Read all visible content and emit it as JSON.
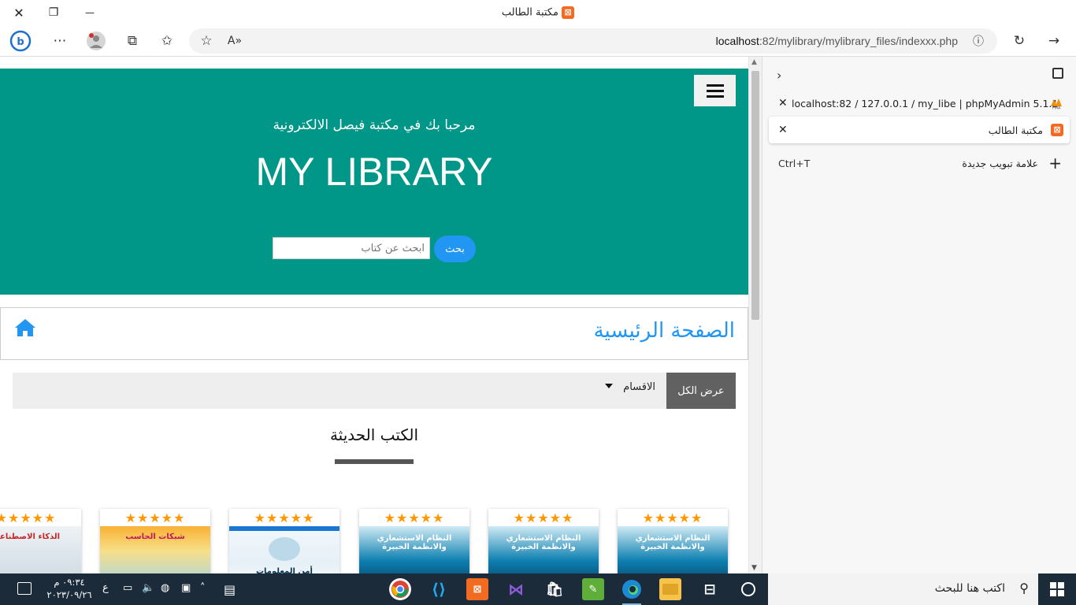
{
  "window": {
    "title": "مكتبة الطالب",
    "close": "✕",
    "restore": "❐",
    "minimize": "—"
  },
  "toolbar": {
    "url_host": "localhost",
    "url_rest": ":82/mylibrary/mylibrary_files/indexxx.php"
  },
  "hero": {
    "welcome": "مرحبا بك في مكتبة فيصل الالكترونية",
    "brand": "MY LIBRARY",
    "search_placeholder": "ابحث عن كتاب",
    "search_button": "بحث"
  },
  "breadcrumb": {
    "title": "الصفحة الرئيسية"
  },
  "filter": {
    "show_all": "عرض الكل",
    "categories": "الاقسام"
  },
  "section": {
    "title": "الكتب الحديثة"
  },
  "books": [
    {
      "stars": "★★★★★",
      "cover_text": "النظام الاستشعاري والانظمة الخبيرة",
      "rating": 5
    },
    {
      "stars": "★★★★★",
      "cover_text": "النظام الاستشعاري والانظمة الخبيرة",
      "rating": 5
    },
    {
      "stars": "★★★★★",
      "cover_text": "النظام الاستشعاري والانظمة الخبيرة",
      "rating": 5
    },
    {
      "stars": "★★★★★",
      "cover_text": "أمن المعلومات",
      "rating": 5
    },
    {
      "stars": "★★★★★",
      "cover_text": "شبكات الحاسب",
      "rating": 5
    },
    {
      "stars": "★★★★★",
      "cover_text": "الذكاء الاصطناعي",
      "rating": 5
    }
  ],
  "sidebar": {
    "tabs": [
      {
        "label": "localhost:82 / 127.0.0.1 / my_libe | phpMyAdmin 5.1.1",
        "icon": "phpmyadmin-icon"
      },
      {
        "label": "مكتبة الطالب",
        "icon": "xampp-icon",
        "active": true
      }
    ],
    "new_tab": "علامة تبويب جديدة",
    "new_tab_shortcut": "Ctrl+T"
  },
  "taskbar": {
    "search_placeholder": "اكتب هنا للبحث",
    "time": "٠٩:٣٤ م",
    "date": "٢٠٢٣/٠٩/٢٦",
    "lang": "ع",
    "accent": "#1c2b3a"
  },
  "colors": {
    "hero_bg": "#009688",
    "link_blue": "#2196F3",
    "star": "#ff9800"
  }
}
